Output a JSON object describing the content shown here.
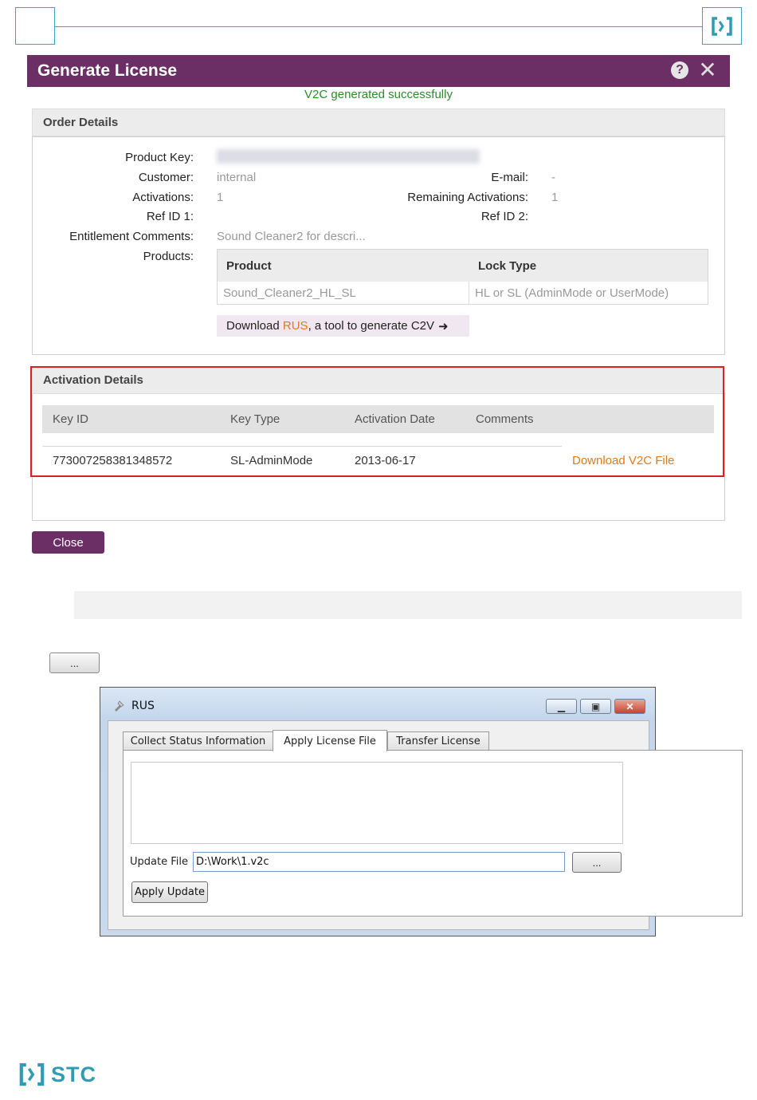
{
  "dialog": {
    "title": "Generate License",
    "success_message": "V2C generated successfully"
  },
  "order": {
    "section_title": "Order Details",
    "labels": {
      "product_key": "Product Key:",
      "customer": "Customer:",
      "activations": "Activations:",
      "ref_id_1": "Ref ID 1:",
      "entitlement_comments": "Entitlement Comments:",
      "products": "Products:",
      "email": "E-mail:",
      "remaining_activations": "Remaining Activations:",
      "ref_id_2": "Ref ID 2:"
    },
    "values": {
      "customer": "internal",
      "activations": "1",
      "entitlement_comments": "Sound Cleaner2 for descri...",
      "email": "-",
      "remaining_activations": "1"
    },
    "products_table": {
      "headers": [
        "Product",
        "Lock Type"
      ],
      "rows": [
        [
          "Sound_Cleaner2_HL_SL",
          "HL or SL (AdminMode or UserMode)"
        ]
      ]
    },
    "rus_link": {
      "prefix": "Download ",
      "highlight": "RUS",
      "suffix": ", a tool to generate C2V"
    }
  },
  "activation": {
    "section_title": "Activation Details",
    "headers": [
      "Key ID",
      "Key Type",
      "Activation Date",
      "Comments"
    ],
    "rows": [
      {
        "key_id": "773007258381348572",
        "key_type": "SL-AdminMode",
        "date": "2013-06-17",
        "comments": "",
        "action": "Download V2C File"
      }
    ]
  },
  "buttons": {
    "close": "Close",
    "ellipsis": "..."
  },
  "rus_window": {
    "title": "RUS",
    "tabs": [
      "Collect Status Information",
      "Apply License File",
      "Transfer License"
    ],
    "active_tab": 1,
    "update_file_label": "Update File",
    "update_file_value": "D:\\Work\\1.v2c",
    "browse_label": "...",
    "apply_label": "Apply Update"
  },
  "footer": {
    "brand": "STC"
  },
  "colors": {
    "title_bar": "#6b2f65",
    "success": "#2d8a2d",
    "link_orange": "#e07a1a",
    "highlight_border": "#e02020",
    "brand_teal": "#2f9cb4"
  }
}
